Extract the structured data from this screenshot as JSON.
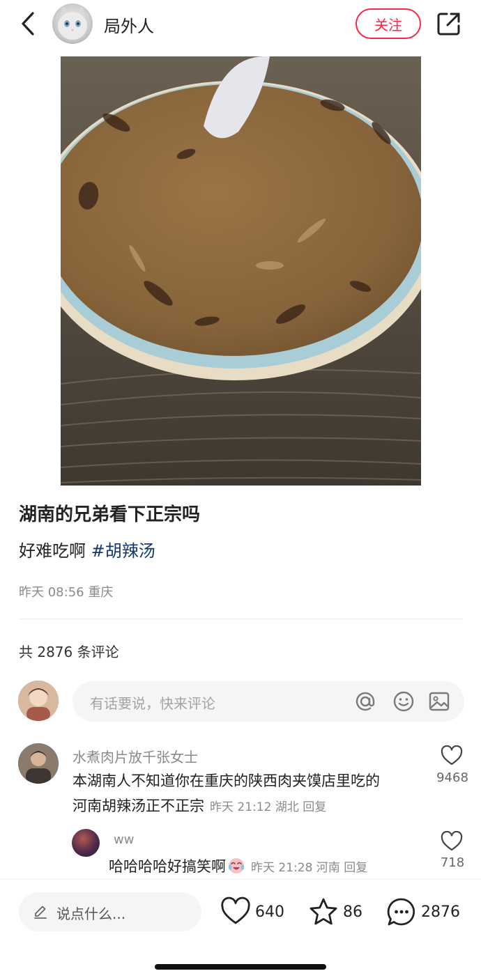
{
  "header": {
    "username": "局外人",
    "follow_label": "关注",
    "back_icon": "chevron-left-icon",
    "share_icon": "share-icon"
  },
  "post": {
    "title": "湖南的兄弟看下正宗吗",
    "body_text": "好难吃啊",
    "hashtag": "#胡辣汤",
    "meta": "昨天 08:56 重庆"
  },
  "comments_section": {
    "count_label": "共 2876 条评论",
    "input_placeholder": "有话要说，快来评论",
    "input_icons": [
      "at-icon",
      "emoji-icon",
      "image-icon"
    ]
  },
  "comments": [
    {
      "name": "水煮肉片放千张女士",
      "text_line1": "本湖南人不知道你在重庆的陕西肉夹馍店里吃的",
      "text_line2": "河南胡辣汤正不正宗",
      "meta": "昨天 21:12 湖北 回复",
      "likes": "9468",
      "replies": [
        {
          "name": "ww",
          "text": "哈哈哈哈好搞笑啊",
          "meta": "昨天 21:28 河南 回复",
          "likes": "718"
        }
      ]
    }
  ],
  "bottom_bar": {
    "say_placeholder": "说点什么...",
    "likes": "640",
    "stars": "86",
    "comments": "2876"
  },
  "colors": {
    "accent": "#ff2442",
    "hashtag": "#13386c",
    "muted": "#8a8a8a"
  }
}
